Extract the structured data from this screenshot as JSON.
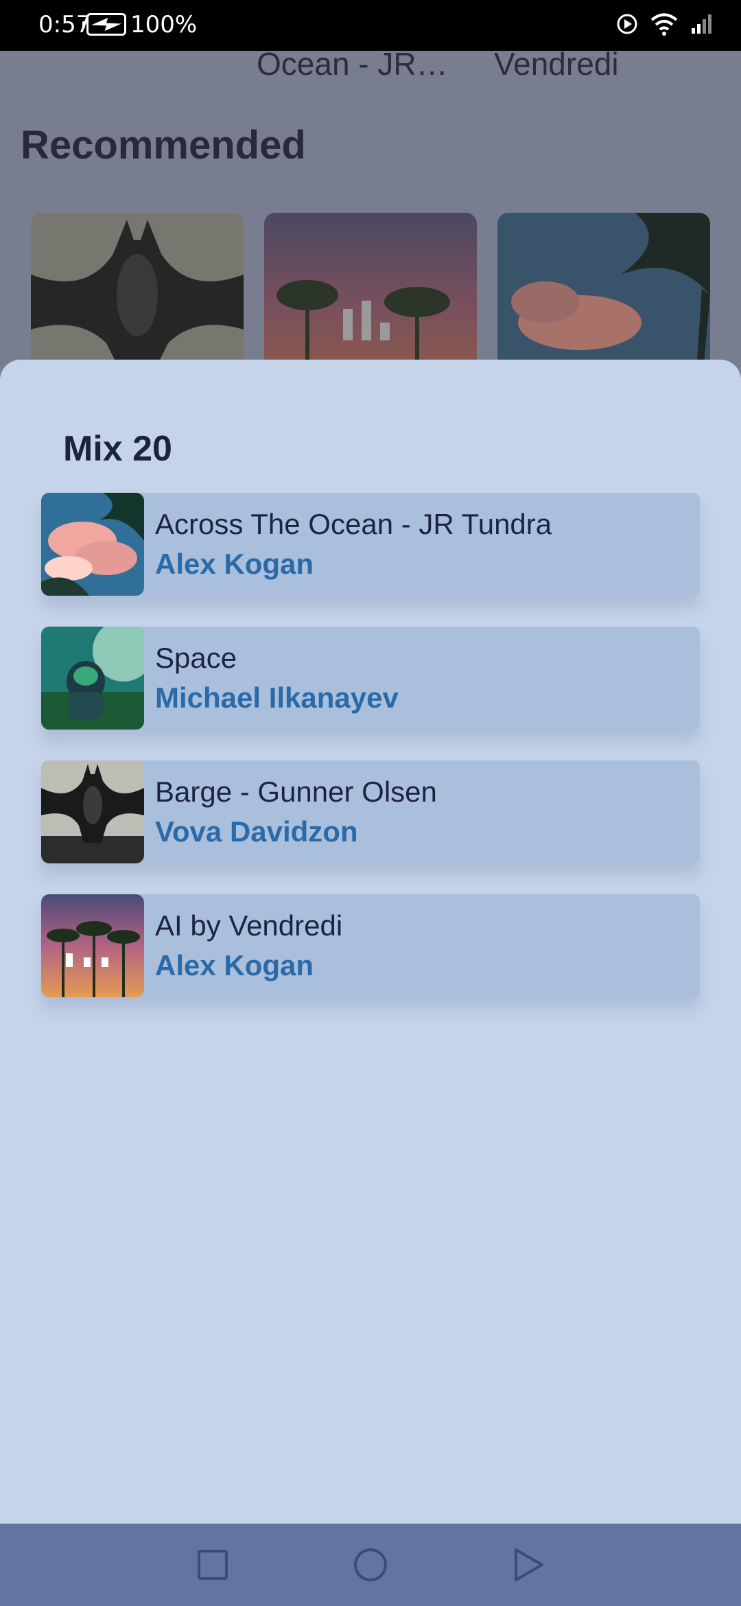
{
  "status_bar": {
    "time": "0:57",
    "battery": "100%",
    "icons": [
      "media-playing-icon",
      "wifi-icon",
      "cell-signal-icon",
      "battery-charging-icon"
    ]
  },
  "background": {
    "now_playing_left": "Ocean - JR…",
    "now_playing_right": "Vendredi",
    "section_title": "Recommended"
  },
  "sheet": {
    "title": "Mix 20",
    "tracks": [
      {
        "title": "Across The Ocean - JR Tundra",
        "artist": "Alex Kogan",
        "art": "palm-clouds-art"
      },
      {
        "title": "Space",
        "artist": "Michael Ilkanayev",
        "art": "astronaut-art"
      },
      {
        "title": "Barge - Gunner Olsen",
        "artist": "Vova Davidzon",
        "art": "batman-art"
      },
      {
        "title": "AI by Vendredi",
        "artist": "Alex Kogan",
        "art": "sunset-palms-art"
      }
    ]
  },
  "nav": {
    "icons": [
      "recents-square-icon",
      "home-circle-icon",
      "back-triangle-icon"
    ]
  },
  "colors": {
    "sheet_bg": "#c5d4ea",
    "track_bg": "#a9bfdc",
    "artist": "#2b6aa8",
    "title": "#1d2440",
    "nav_bg": "#6474a0"
  }
}
